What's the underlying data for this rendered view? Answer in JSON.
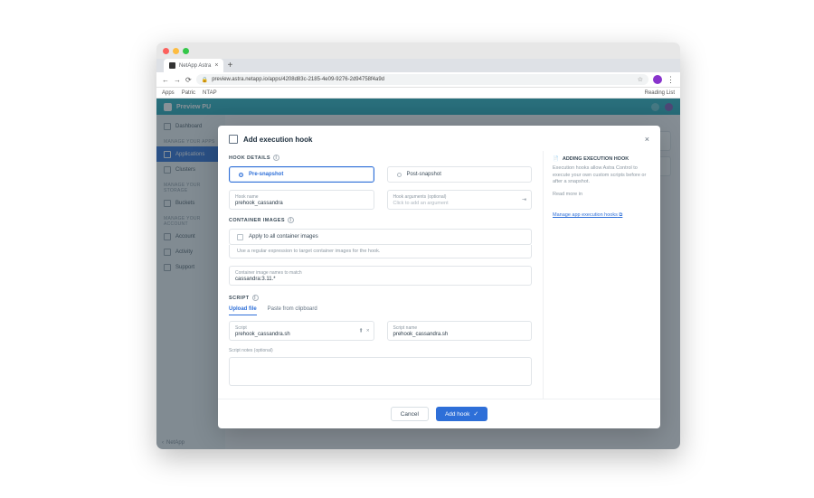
{
  "browser": {
    "tab_title": "NetApp Astra",
    "url": "preview.astra.netapp.io/apps/4208d83c-2185-4e09-9276-2d94758f4a9d",
    "bookmarks": {
      "apps": "Apps",
      "b1": "Patric",
      "b2": "NTAP",
      "reading_list": "Reading List"
    }
  },
  "app": {
    "product": "Preview PU",
    "sidebar": {
      "items": [
        "Dashboard",
        "Applications",
        "Clusters",
        "Buckets",
        "Account",
        "Activity",
        "Support"
      ],
      "sections": [
        "MANAGE YOUR APPS",
        "MANAGE YOUR STORAGE",
        "MANAGE YOUR ACCOUNT"
      ],
      "footer_brand": "NetApp"
    }
  },
  "modal": {
    "title": "Add execution hook",
    "sections": {
      "hook": "HOOK DETAILS",
      "images": "CONTAINER IMAGES",
      "script": "SCRIPT"
    },
    "hook_type": {
      "pre": "Pre-snapshot",
      "post": "Post-snapshot"
    },
    "hook_name": {
      "label": "Hook name",
      "value": "prehook_cassandra"
    },
    "hook_args": {
      "label": "Hook arguments (optional)",
      "placeholder": "Click to add an argument"
    },
    "apply_all": "Apply to all container images",
    "regex_hint": "Use a regular expression to target container images for the hook.",
    "image_match": {
      "label": "Container image names to match",
      "value": "cassandra:3.11.*"
    },
    "tabs": {
      "upload": "Upload file",
      "paste": "Paste from clipboard"
    },
    "script_file": {
      "label": "Script",
      "value": "prehook_cassandra.sh"
    },
    "script_name": {
      "label": "Script name",
      "value": "prehook_cassandra.sh"
    },
    "notes_label": "Script notes (optional)",
    "buttons": {
      "cancel": "Cancel",
      "add": "Add hook"
    },
    "side": {
      "title": "ADDING EXECUTION HOOK",
      "p1": "Execution hooks allow Astra Control to execute your own custom scripts before or after a snapshot.",
      "read_more": "Read more in",
      "link": "Manage app execution hooks"
    }
  }
}
